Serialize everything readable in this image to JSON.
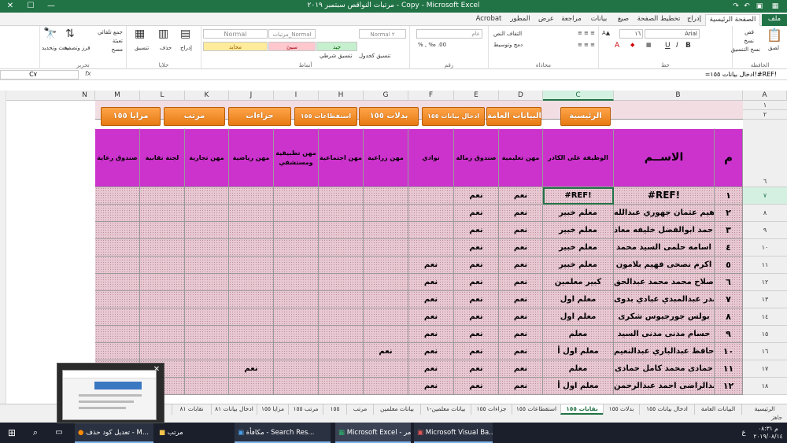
{
  "window": {
    "title": "مرتبات النواقص سبتمبر ٢٠١٩ - Copy - Microsoft Excel"
  },
  "titlebar_controls": {
    "close": "✕",
    "maximize": "☐",
    "minimize": "—"
  },
  "ribbon_tabs": [
    "ملف",
    "الصفحة الرئيسية",
    "إدراج",
    "تخطيط الصفحة",
    "صيغ",
    "بيانات",
    "مراجعة",
    "عرض",
    "المطور",
    "Acrobat"
  ],
  "ribbon": {
    "clipboard": {
      "label": "الحافظة",
      "paste": "لصق",
      "cut": "قص",
      "copy": "نسخ",
      "painter": "نسخ التنسيق"
    },
    "font": {
      "label": "خط",
      "name": "Arial",
      "size": "١٦"
    },
    "alignment": {
      "label": "محاذاة",
      "wrap": "التفاف النص",
      "merge": "دمج وتوسيط"
    },
    "number": {
      "label": "رقم",
      "format": "عام"
    },
    "styles": {
      "label": "أنماط",
      "cells": [
        "Normal ٢",
        "مرتبات_Normal",
        "Normal",
        "جيد",
        "سيئ",
        "محايد"
      ],
      "cond": "تنسيق شرطي",
      "table": "تنسيق كجدول"
    },
    "cells": {
      "label": "خلايا",
      "insert": "إدراج",
      "delete": "حذف",
      "format": "تنسيق"
    },
    "editing": {
      "label": "تحرير",
      "autosum": "جمع تلقائي",
      "fill": "تعبئة",
      "clear": "مسح",
      "sort": "فرز وتصفية",
      "find": "بحث وتحديد"
    }
  },
  "formula_bar": {
    "name_box": "C٧",
    "fx": "fx",
    "formula": "=ادخال بيانات ١٥٥!#REF!"
  },
  "columns": [
    "A",
    "B",
    "C",
    "D",
    "E",
    "F",
    "G",
    "H",
    "I",
    "J",
    "K",
    "L",
    "M",
    "N"
  ],
  "row_numbers": [
    "١",
    "٢",
    "٦",
    "٧",
    "٨",
    "٩",
    "١٠",
    "١١",
    "١٢",
    "١٣",
    "١٤",
    "١٥",
    "١٦",
    "١٧",
    "١٨"
  ],
  "buttons": [
    "الرئيسية",
    "البيانات العامة",
    "ادخال بيانات ١٥٥",
    "بدلات ١٥٥",
    "استقطاعات ١٥٥",
    "جزاءات",
    "مرتب",
    "مزايا ١٥٥"
  ],
  "headers": {
    "m": "م",
    "name": "الاســم",
    "job": "الوظيفة على الكادر",
    "teach": "مهن تعليمية",
    "fund": "صندوق زمالة",
    "clubs": "نوادي",
    "agri": "مهن زراعية",
    "social": "مهن اجتماعية",
    "applied": "مهن تطبيقية ومستشفي",
    "sports": "مهن رياضية",
    "trade": "مهن تجارية",
    "union": "لجنة نقابية",
    "care": "صندوق رعاية"
  },
  "rows": [
    {
      "m": "١",
      "name": "#REF!",
      "job": "#REF!",
      "teach": "نعم",
      "fund": "نعم",
      "clubs": "",
      "agri": "",
      "sports": ""
    },
    {
      "m": "٢",
      "name": "ابراهيم عثمان جهوري عبدالله",
      "job": "معلم خبير",
      "teach": "نعم",
      "fund": "نعم",
      "clubs": "",
      "agri": "",
      "sports": ""
    },
    {
      "m": "٣",
      "name": "احمد ابوالفضل خليفه معاذ",
      "job": "معلم خبير",
      "teach": "نعم",
      "fund": "نعم",
      "clubs": "",
      "agri": "",
      "sports": ""
    },
    {
      "m": "٤",
      "name": "اسامه حلمى السيد محمد",
      "job": "معلم خبير",
      "teach": "نعم",
      "fund": "نعم",
      "clubs": "",
      "agri": "",
      "sports": ""
    },
    {
      "m": "٥",
      "name": "اكرم نصحى فهيم بلامون",
      "job": "معلم خبير",
      "teach": "نعم",
      "fund": "نعم",
      "clubs": "نعم",
      "agri": "",
      "sports": ""
    },
    {
      "m": "٦",
      "name": "بدرى صلاح محمد محمد عبدالحق",
      "job": "كبير معلمين",
      "teach": "نعم",
      "fund": "نعم",
      "clubs": "نعم",
      "agri": "",
      "sports": ""
    },
    {
      "m": "٧",
      "name": "بندر عبدالمبدي عبادي بدوى",
      "job": "معلم اول",
      "teach": "نعم",
      "fund": "نعم",
      "clubs": "نعم",
      "agri": "",
      "sports": ""
    },
    {
      "m": "٨",
      "name": "بولس جورجيوس شكرى",
      "job": "معلم اول",
      "teach": "نعم",
      "fund": "نعم",
      "clubs": "نعم",
      "agri": "",
      "sports": ""
    },
    {
      "m": "٩",
      "name": "حسام مدنى مدنى السيد",
      "job": "معلم",
      "teach": "نعم",
      "fund": "نعم",
      "clubs": "نعم",
      "agri": "",
      "sports": ""
    },
    {
      "m": "١٠",
      "name": "حسين حافظ عبدالباري عبدالنعيم",
      "job": "معلم اول أ",
      "teach": "نعم",
      "fund": "نعم",
      "clubs": "نعم",
      "agri": "نعم",
      "sports": ""
    },
    {
      "m": "١١",
      "name": "حمادى محمد كامل حمادى",
      "job": "معلم",
      "teach": "نعم",
      "fund": "نعم",
      "clubs": "نعم",
      "agri": "",
      "sports": "نعم"
    },
    {
      "m": "١٢",
      "name": "خالد عبدالراضى احمد عبدالرحمن",
      "job": "معلم اول أ",
      "teach": "نعم",
      "fund": "نعم",
      "clubs": "نعم",
      "agri": "",
      "sports": ""
    }
  ],
  "sheet_tabs": [
    "الرئيسية",
    "البيانات العامة",
    "ادخال بيانات ١٥٥",
    "بدلات ١٥٥",
    "نقابات ١٥٥",
    "استقطاعات ١٥٥",
    "جزاءات ١٥٥",
    "بيانات معلمين-١",
    "بيانات معلمين",
    "مرتب",
    "١٥٥",
    "مرتب ١٥٥",
    "مزايا ١٥٥",
    "ادخال بيانات ٨١",
    "نقابات ٨١"
  ],
  "status": {
    "ready": "جاهز"
  },
  "taskbar": {
    "items": [
      "تعديل كود حذف - M...",
      "مرتب",
      "مكافأة - Search Res...",
      "Microsoft Excel - مر...",
      "Microsoft Visual Ba..."
    ],
    "time": "م ٠٨:٣١",
    "date": "٢٠١٩/٠٨/١٤",
    "lang": "ع"
  }
}
